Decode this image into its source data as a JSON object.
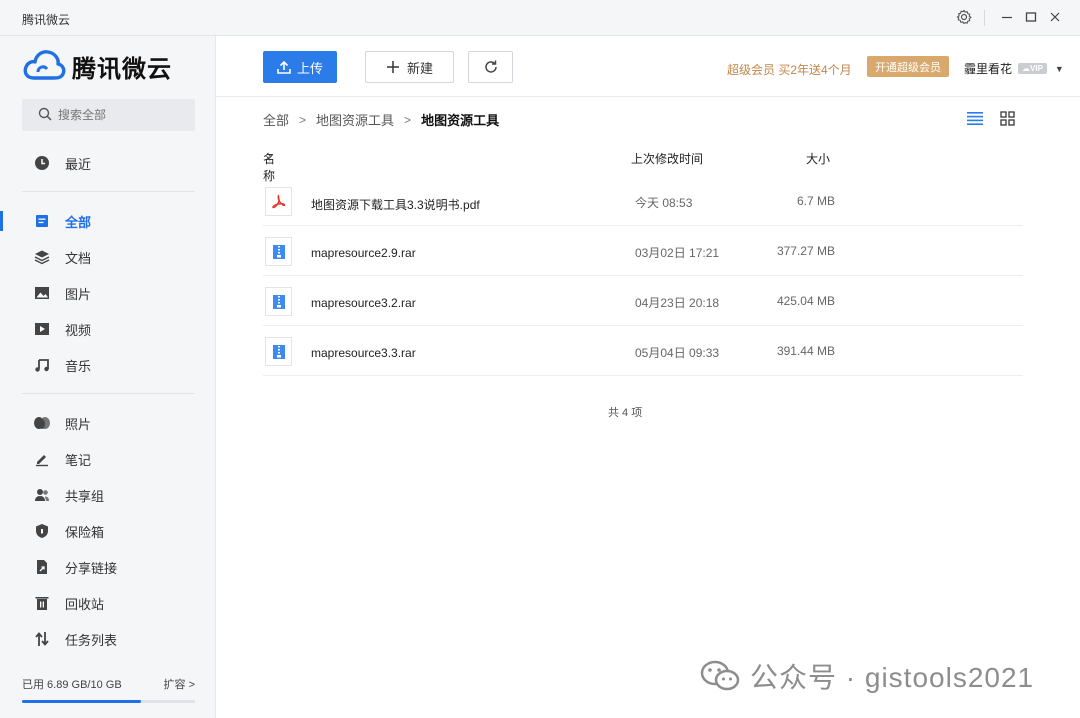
{
  "window": {
    "title": "腾讯微云",
    "controls": [
      "settings-icon",
      "minimize-icon",
      "maximize-icon",
      "close-icon"
    ]
  },
  "sidebar": {
    "logo_text": "腾讯微云",
    "search_placeholder": "搜索全部",
    "groups": [
      [
        {
          "label": "最近",
          "icon": "clock-icon",
          "active": false
        }
      ],
      [
        {
          "label": "全部",
          "icon": "all-files-icon",
          "active": true
        },
        {
          "label": "文档",
          "icon": "layers-icon",
          "active": false
        },
        {
          "label": "图片",
          "icon": "image-icon",
          "active": false
        },
        {
          "label": "视频",
          "icon": "video-icon",
          "active": false
        },
        {
          "label": "音乐",
          "icon": "music-icon",
          "active": false
        }
      ],
      [
        {
          "label": "照片",
          "icon": "photos-icon",
          "active": false
        },
        {
          "label": "笔记",
          "icon": "pen-icon",
          "active": false
        },
        {
          "label": "共享组",
          "icon": "users-icon",
          "active": false
        },
        {
          "label": "保险箱",
          "icon": "shield-icon",
          "active": false
        },
        {
          "label": "分享链接",
          "icon": "share-link-icon",
          "active": false
        },
        {
          "label": "回收站",
          "icon": "trash-icon",
          "active": false
        },
        {
          "label": "任务列表",
          "icon": "transfer-icon",
          "active": false
        }
      ]
    ],
    "storage": {
      "used_label": "已用 6.89 GB/10 GB",
      "expand_label": "扩容 >",
      "used_fraction": 0.689
    }
  },
  "toolbar": {
    "upload_label": "上传",
    "new_label": "新建",
    "promo_text": "超级会员 买2年送4个月",
    "vip_button_label": "开通超级会员",
    "username": "霾里看花",
    "vip_badge": "VIP"
  },
  "breadcrumb": {
    "items": [
      "全部",
      "地图资源工具"
    ],
    "current": "地图资源工具"
  },
  "file_table": {
    "columns": {
      "name": "名称",
      "modified": "上次修改时间",
      "size": "大小"
    },
    "rows": [
      {
        "name": "地图资源下载工具3.3说明书.pdf",
        "modified": "今天 08:53",
        "size": "6.7 MB",
        "type": "pdf"
      },
      {
        "name": "mapresource2.9.rar",
        "modified": "03月02日 17:21",
        "size": "377.27 MB",
        "type": "rar"
      },
      {
        "name": "mapresource3.2.rar",
        "modified": "04月23日 20:18",
        "size": "425.04 MB",
        "type": "rar"
      },
      {
        "name": "mapresource3.3.rar",
        "modified": "05月04日 09:33",
        "size": "391.44 MB",
        "type": "rar"
      }
    ],
    "total_label": "共 4 项"
  },
  "watermark": {
    "text": "公众号 · gistools2021"
  },
  "colors": {
    "accent": "#1f6fe5",
    "upload_button": "#2b7be8",
    "vip_gold": "#d9a86c",
    "promo_text": "#c2874a",
    "pdf_red": "#e0352b"
  }
}
